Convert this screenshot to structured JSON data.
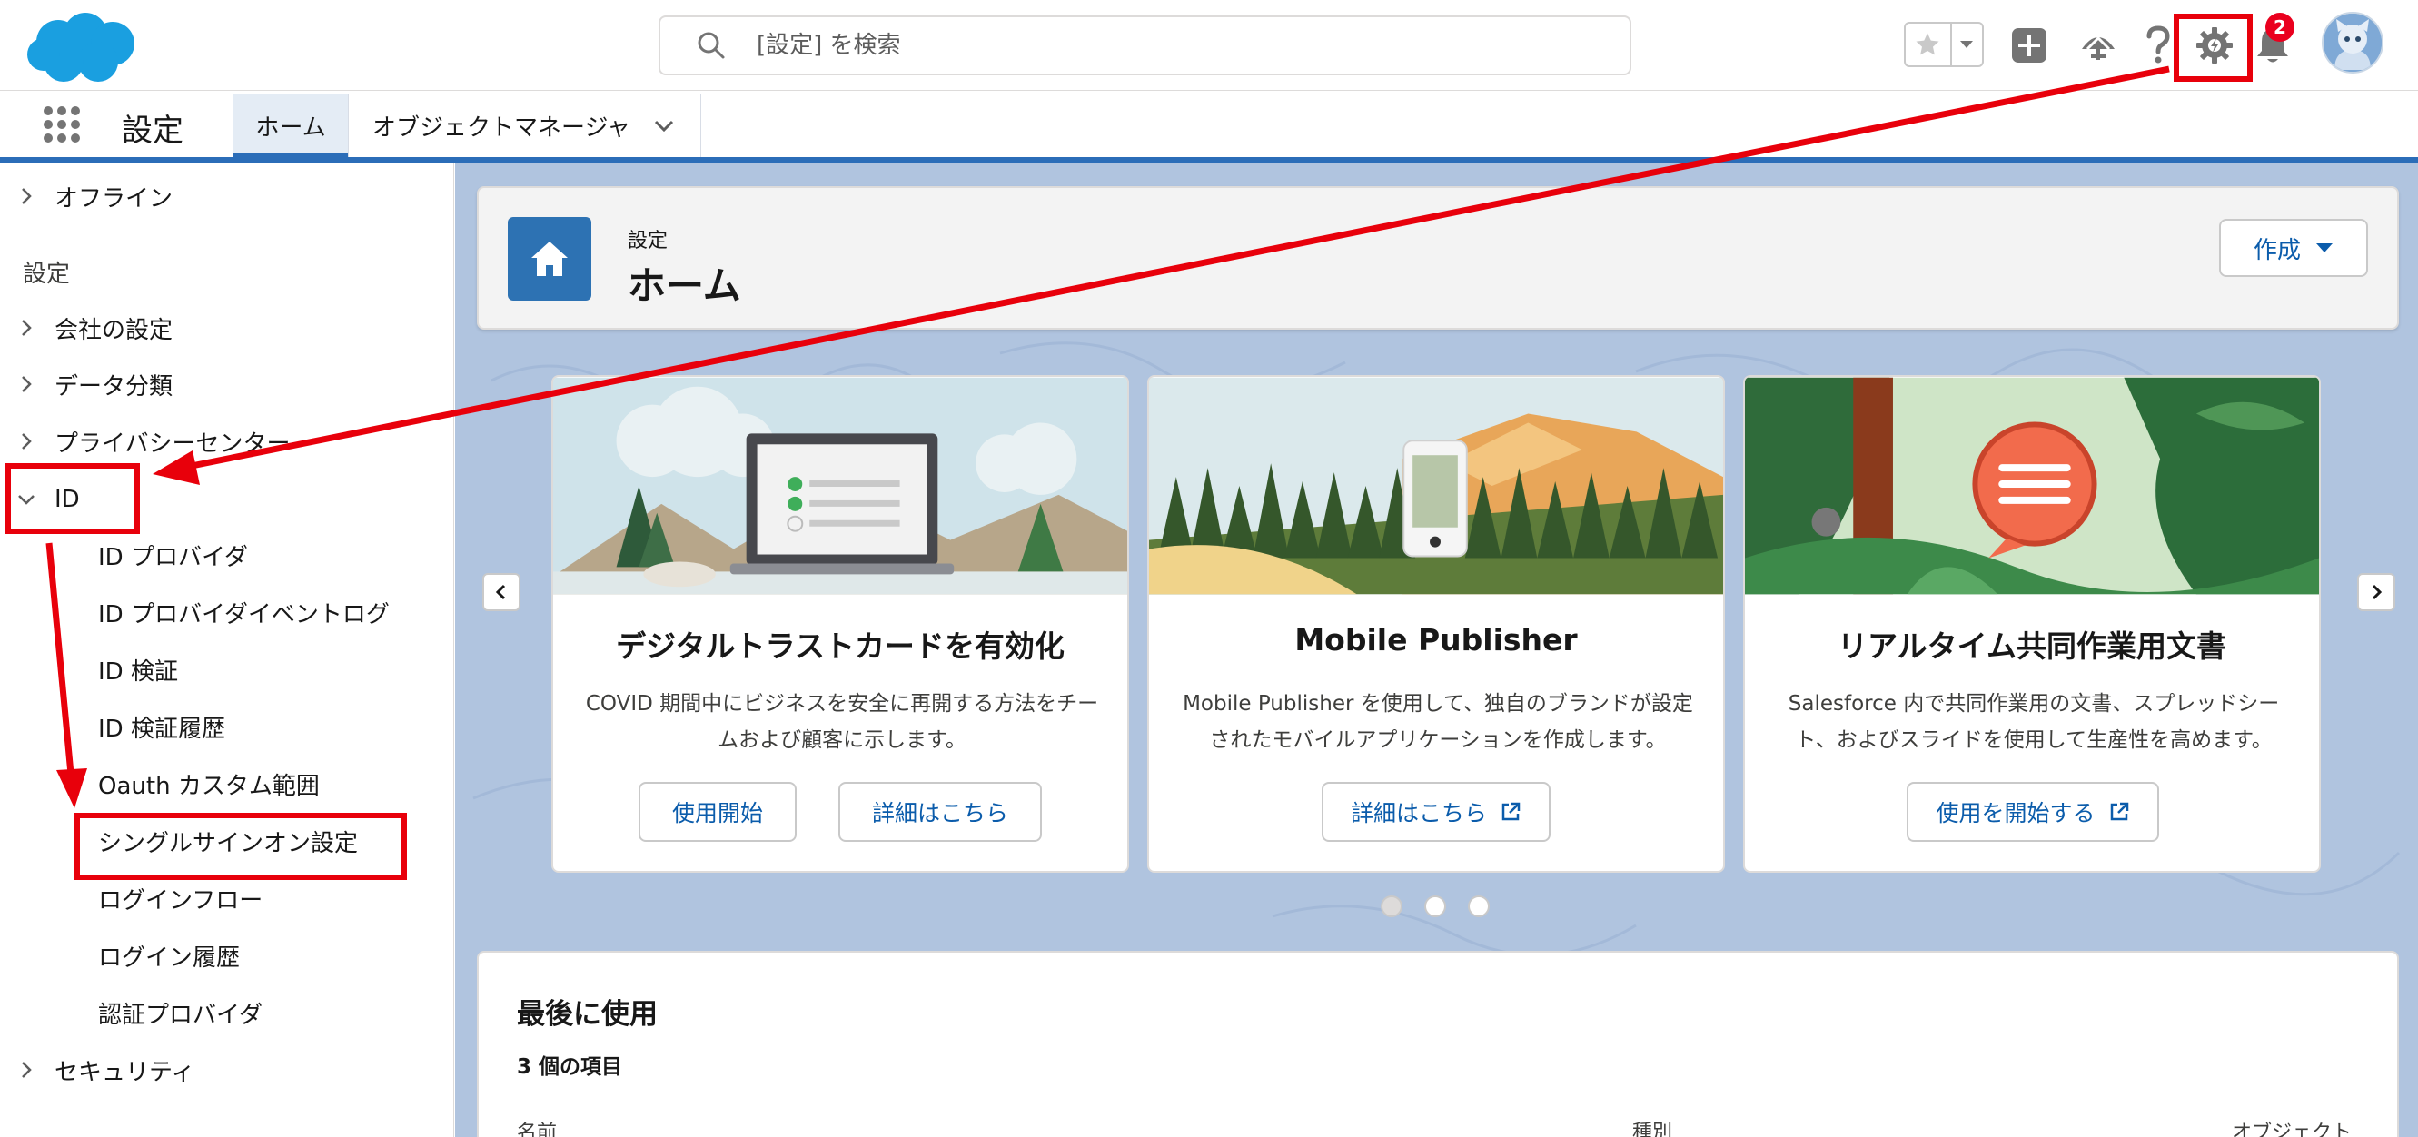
{
  "header": {
    "search_placeholder": "[設定] を検索",
    "notification_count": "2"
  },
  "nav": {
    "app_title": "設定",
    "tabs": [
      {
        "label": "ホーム"
      },
      {
        "label": "オブジェクトマネージャ"
      }
    ]
  },
  "sidebar": {
    "top_item": "オフライン",
    "section_heading": "設定",
    "items": [
      {
        "label": "会社の設定"
      },
      {
        "label": "データ分類"
      },
      {
        "label": "プライバシーセンター"
      },
      {
        "label": "ID"
      }
    ],
    "id_children": [
      {
        "label": "ID プロバイダ"
      },
      {
        "label": "ID プロバイダイベントログ"
      },
      {
        "label": "ID 検証"
      },
      {
        "label": "ID 検証履歴"
      },
      {
        "label": "Oauth カスタム範囲"
      },
      {
        "label": "シングルサインオン設定"
      },
      {
        "label": "ログインフロー"
      },
      {
        "label": "ログイン履歴"
      },
      {
        "label": "認証プロバイダ"
      }
    ],
    "bottom_item": "セキュリティ"
  },
  "page_header": {
    "subtitle": "設定",
    "title": "ホーム",
    "create_label": "作成"
  },
  "cards": [
    {
      "title": "デジタルトラストカードを有効化",
      "description": "COVID 期間中にビジネスを安全に再開する方法をチームおよび顧客に示します。",
      "buttons": [
        "使用開始",
        "詳細はこちら"
      ]
    },
    {
      "title": "Mobile Publisher",
      "description": "Mobile Publisher を使用して、独自のブランドが設定されたモバイルアプリケーションを作成します。",
      "buttons": [
        "詳細はこちら"
      ]
    },
    {
      "title": "リアルタイム共同作業用文書",
      "description": "Salesforce 内で共同作業用の文書、スプレッドシート、およびスライドを使用して生産性を高めます。",
      "buttons": [
        "使用を開始する"
      ]
    }
  ],
  "recent": {
    "title": "最後に使用",
    "count": "3 個の項目",
    "columns": [
      "名前",
      "種別",
      "オブジェクト"
    ]
  },
  "colors": {
    "annotation_red": "#e8000b",
    "brand_blue": "#2b6db8",
    "link_blue": "#0b5cab",
    "salesforce_cloud": "#1a9fe0"
  },
  "icons": [
    "salesforce-logo",
    "search-icon",
    "star-icon",
    "add-icon",
    "trailhead-icon",
    "help-icon",
    "gear-icon",
    "bell-icon",
    "avatar",
    "app-launcher-icon",
    "home-icon",
    "external-link-icon"
  ]
}
